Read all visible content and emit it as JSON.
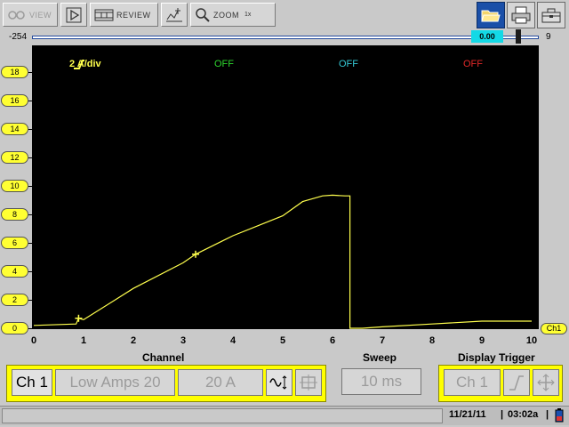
{
  "toolbar": {
    "view_label": "VIEW",
    "review_label": "REVIEW",
    "zoom_label": "ZOOM",
    "zoom_level": "1x"
  },
  "slider": {
    "min": "-254",
    "max": "9",
    "value": "0.00",
    "position_fraction": 0.96
  },
  "plot": {
    "channel_scale": "2 A/div",
    "ch2_state": "OFF",
    "ch3_state": "OFF",
    "ch4_state": "OFF",
    "channel_tag": "Ch1"
  },
  "axes": {
    "y_ticks": [
      "18",
      "16",
      "14",
      "12",
      "10",
      "8",
      "6",
      "4",
      "2",
      "0"
    ],
    "x_ticks": [
      "0",
      "1",
      "2",
      "3",
      "4",
      "5",
      "6",
      "7",
      "8",
      "9",
      "10"
    ]
  },
  "chart_data": {
    "type": "line",
    "xlim": [
      0,
      10
    ],
    "ylim": [
      0,
      19.5
    ],
    "grid": false,
    "series": [
      {
        "color": "#ffff4d",
        "x": [
          0.0,
          0.85,
          0.9,
          1.0,
          2.0,
          3.0,
          3.25,
          4.0,
          5.0,
          5.4,
          5.8,
          6.0,
          6.25,
          6.35,
          6.35,
          6.6,
          7.0,
          8.0,
          9.0,
          10.0
        ],
        "y": [
          0.2,
          0.3,
          0.7,
          0.6,
          2.8,
          4.6,
          5.2,
          6.5,
          7.9,
          8.9,
          9.3,
          9.35,
          9.3,
          9.3,
          0.0,
          0.0,
          0.1,
          0.3,
          0.5,
          0.5
        ]
      }
    ],
    "markers": [
      {
        "x": 0.9,
        "y": 0.7
      },
      {
        "x": 3.25,
        "y": 5.2
      }
    ]
  },
  "labels": {
    "channel": "Channel",
    "sweep": "Sweep",
    "display_trigger": "Display Trigger"
  },
  "controls": {
    "channel_btn": "Ch 1",
    "probe_btn": "Low Amps 20",
    "range_btn": "20 A",
    "sweep_btn": "10 ms",
    "trigger_ch_btn": "Ch 1"
  },
  "status": {
    "date": "11/21/11",
    "time": "03:02a"
  }
}
